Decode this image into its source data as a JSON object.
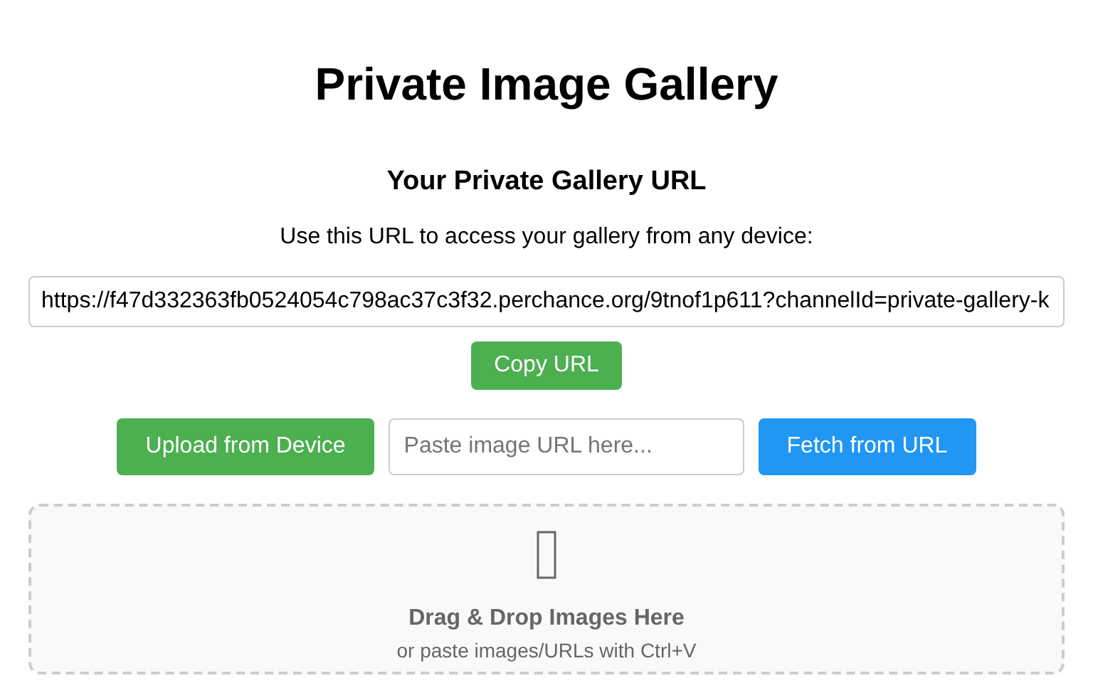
{
  "title": "Private Image Gallery",
  "gallery_url": {
    "heading": "Your Private Gallery URL",
    "description": "Use this URL to access your gallery from any device:",
    "value": "https://f47d332363fb0524054c798ac37c3f32.perchance.org/9tnof1p611?channelId=private-gallery-k",
    "copy_button": "Copy URL"
  },
  "upload": {
    "upload_button": "Upload from Device",
    "url_field": {
      "placeholder": "Paste image URL here..."
    },
    "fetch_button": "Fetch from URL"
  },
  "drop_zone": {
    "title": "Drag & Drop Images Here",
    "subtitle": "or paste images/URLs with Ctrl+V"
  }
}
